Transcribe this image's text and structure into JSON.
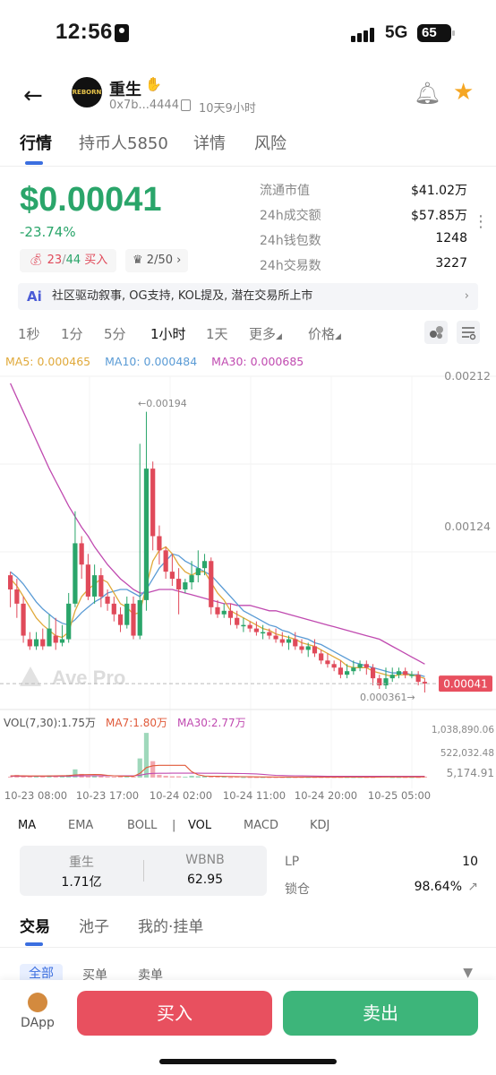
{
  "status_bar": {
    "time": "12:56",
    "network": "5G",
    "battery": "65"
  },
  "header": {
    "token_name": "重生",
    "logo_text": "REBORN",
    "address": "0x7b...4444",
    "age": "10天9小时",
    "icons": [
      "back-arrow-icon",
      "copy-icon",
      "bell-icon",
      "star-icon"
    ]
  },
  "tabs": [
    "行情",
    "持币人5850",
    "详情",
    "风险"
  ],
  "price": {
    "value": "$0.00041",
    "change": "-23.74%",
    "buy_count": "23",
    "sell_count": "44",
    "buy_label": "买入",
    "rank": "2/50",
    "colors": {
      "up": "#2aa56a",
      "down": "#e04a5a"
    }
  },
  "stats": [
    {
      "label": "流通市值",
      "value": "$41.02万"
    },
    {
      "label": "24h成交额",
      "value": "$57.85万"
    },
    {
      "label": "24h钱包数",
      "value": "1248"
    },
    {
      "label": "24h交易数",
      "value": "3227"
    }
  ],
  "narrative": {
    "ai_label": "Ai",
    "text": "社区驱动叙事, OG支持, KOL提及, 潜在交易所上市"
  },
  "timeframes": [
    "1秒",
    "1分",
    "5分",
    "1小时",
    "1天",
    "更多",
    "价格"
  ],
  "active_timeframe": "1小时",
  "ma_legend": {
    "ma5": "MA5: 0.000465",
    "ma10": "MA10: 0.000484",
    "ma30": "MA30: 0.000685"
  },
  "chart_data": {
    "type": "candlestick",
    "watermark": "Ave Pro",
    "y_ticks": [
      "0.00212",
      "0.00124"
    ],
    "current_price_tag": "0.00041",
    "high_annotation": "←0.00194",
    "low_annotation": "0.000361→",
    "x_labels": [
      "10-23 08:00",
      "10-23 17:00",
      "10-24 02:00",
      "10-24 11:00",
      "10-24 20:00",
      "10-25 05:00"
    ],
    "ylim": [
      0.00035,
      0.00214
    ],
    "candles": [
      [
        0.00102,
        0.00094,
        0.00104,
        0.00084
      ],
      [
        0.00094,
        0.00086,
        0.001,
        0.00078
      ],
      [
        0.00086,
        0.00068,
        0.0009,
        0.00064
      ],
      [
        0.00066,
        0.00062,
        0.0007,
        0.0006
      ],
      [
        0.00062,
        0.00066,
        0.0007,
        0.0006
      ],
      [
        0.00066,
        0.00062,
        0.00072,
        0.0006
      ],
      [
        0.00062,
        0.00072,
        0.0008,
        0.00062
      ],
      [
        0.00068,
        0.00064,
        0.00078,
        0.0006
      ],
      [
        0.00064,
        0.00066,
        0.00074,
        0.00062
      ],
      [
        0.00066,
        0.00086,
        0.00092,
        0.00064
      ],
      [
        0.00086,
        0.0012,
        0.00138,
        0.00084
      ],
      [
        0.0012,
        0.00108,
        0.00124,
        0.001
      ],
      [
        0.00108,
        0.0009,
        0.00114,
        0.00088
      ],
      [
        0.0009,
        0.00102,
        0.00108,
        0.00086
      ],
      [
        0.00102,
        0.0009,
        0.00106,
        0.00084
      ],
      [
        0.0009,
        0.00086,
        0.00094,
        0.00082
      ],
      [
        0.00086,
        0.0008,
        0.0009,
        0.00076
      ],
      [
        0.0008,
        0.00074,
        0.00084,
        0.0007
      ],
      [
        0.00074,
        0.00086,
        0.0009,
        0.00072
      ],
      [
        0.00086,
        0.00068,
        0.0009,
        0.00066
      ],
      [
        0.00068,
        0.00088,
        0.00176,
        0.00066
      ],
      [
        0.00088,
        0.00162,
        0.00194,
        0.00082
      ],
      [
        0.00162,
        0.00124,
        0.00166,
        0.00116
      ],
      [
        0.00124,
        0.00116,
        0.0013,
        0.00108
      ],
      [
        0.00116,
        0.00104,
        0.00118,
        0.001
      ],
      [
        0.00104,
        0.001,
        0.00114,
        0.00096
      ],
      [
        0.001,
        0.00094,
        0.00106,
        0.0008
      ],
      [
        0.00094,
        0.00098,
        0.001,
        0.00092
      ],
      [
        0.00098,
        0.00102,
        0.0011,
        0.00094
      ],
      [
        0.00102,
        0.00106,
        0.00116,
        0.00098
      ],
      [
        0.00106,
        0.0011,
        0.00114,
        0.00102
      ],
      [
        0.0011,
        0.00084,
        0.00112,
        0.0008
      ],
      [
        0.00084,
        0.0008,
        0.00088,
        0.00078
      ],
      [
        0.0008,
        0.00082,
        0.00086,
        0.00078
      ],
      [
        0.00082,
        0.00078,
        0.00086,
        0.00074
      ],
      [
        0.00078,
        0.00074,
        0.00082,
        0.00072
      ],
      [
        0.00074,
        0.00074,
        0.00078,
        0.0007
      ],
      [
        0.00074,
        0.00072,
        0.00076,
        0.0007
      ],
      [
        0.00072,
        0.0007,
        0.00076,
        0.00068
      ],
      [
        0.0007,
        0.0007,
        0.00074,
        0.00066
      ],
      [
        0.0007,
        0.00068,
        0.00072,
        0.00066
      ],
      [
        0.00068,
        0.00066,
        0.00072,
        0.00064
      ],
      [
        0.00066,
        0.00064,
        0.0007,
        0.00062
      ],
      [
        0.00064,
        0.00066,
        0.00068,
        0.0006
      ],
      [
        0.00066,
        0.00062,
        0.0007,
        0.0006
      ],
      [
        0.00062,
        0.0006,
        0.00066,
        0.00058
      ],
      [
        0.0006,
        0.00062,
        0.00064,
        0.00056
      ],
      [
        0.00062,
        0.00058,
        0.00066,
        0.00056
      ],
      [
        0.00058,
        0.00054,
        0.0006,
        0.00052
      ],
      [
        0.00054,
        0.00052,
        0.00058,
        0.0005
      ],
      [
        0.00052,
        0.0005,
        0.00054,
        0.00048
      ],
      [
        0.0005,
        0.00046,
        0.00054,
        0.00044
      ],
      [
        0.00046,
        0.00048,
        0.00052,
        0.00044
      ],
      [
        0.00048,
        0.0005,
        0.00054,
        0.00046
      ],
      [
        0.0005,
        0.00052,
        0.00054,
        0.00048
      ],
      [
        0.00052,
        0.0005,
        0.00054,
        0.00046
      ],
      [
        0.0005,
        0.00044,
        0.00052,
        0.0004
      ],
      [
        0.00044,
        0.0004,
        0.00046,
        0.00038
      ],
      [
        0.0004,
        0.00044,
        0.0005,
        0.00038
      ],
      [
        0.00044,
        0.00046,
        0.0005,
        0.00042
      ],
      [
        0.00046,
        0.00048,
        0.0005,
        0.00044
      ],
      [
        0.00048,
        0.00046,
        0.0005,
        0.00044
      ],
      [
        0.00046,
        0.00046,
        0.00048,
        0.00044
      ],
      [
        0.00046,
        0.00042,
        0.00048,
        0.0004
      ],
      [
        0.00042,
        0.00041,
        0.00044,
        0.00036
      ]
    ],
    "ma5": [
      0.001,
      0.00096,
      0.0009,
      0.00084,
      0.00078,
      0.00074,
      0.00071,
      0.00068,
      0.00067,
      0.0007,
      0.00082,
      0.0009,
      0.00094,
      0.00097,
      0.001,
      0.00098,
      0.00092,
      0.00086,
      0.00084,
      0.0008,
      0.00081,
      0.00096,
      0.0011,
      0.00116,
      0.00118,
      0.00114,
      0.00108,
      0.00104,
      0.00102,
      0.00104,
      0.00104,
      0.00098,
      0.00092,
      0.00088,
      0.00082,
      0.0008,
      0.00078,
      0.00076,
      0.00074,
      0.00072,
      0.00071,
      0.00069,
      0.00068,
      0.00067,
      0.00066,
      0.00064,
      0.00063,
      0.00062,
      0.0006,
      0.00058,
      0.00056,
      0.00054,
      0.00051,
      0.0005,
      0.0005,
      0.0005,
      0.00048,
      0.00047,
      0.00046,
      0.00045,
      0.00046,
      0.00046,
      0.00046,
      0.00045,
      0.00044
    ],
    "ma10": [
      0.00104,
      0.00101,
      0.00097,
      0.00092,
      0.00087,
      0.00083,
      0.0008,
      0.00077,
      0.00075,
      0.00074,
      0.00077,
      0.00081,
      0.00084,
      0.00087,
      0.00089,
      0.00092,
      0.00093,
      0.00094,
      0.00094,
      0.00092,
      0.0009,
      0.00094,
      0.001,
      0.00106,
      0.0011,
      0.00114,
      0.00113,
      0.0011,
      0.00108,
      0.00106,
      0.00104,
      0.00102,
      0.00098,
      0.00094,
      0.0009,
      0.00086,
      0.00082,
      0.0008,
      0.00078,
      0.00076,
      0.00074,
      0.00073,
      0.00071,
      0.0007,
      0.00068,
      0.00067,
      0.00066,
      0.00064,
      0.00063,
      0.00061,
      0.00059,
      0.00057,
      0.00055,
      0.00053,
      0.00052,
      0.00051,
      0.0005,
      0.00049,
      0.00048,
      0.00047,
      0.00047,
      0.00047,
      0.00046,
      0.00046,
      0.00045
    ],
    "ma30": [
      0.0021,
      0.00202,
      0.00194,
      0.00186,
      0.00178,
      0.0017,
      0.00162,
      0.00155,
      0.00148,
      0.00141,
      0.00135,
      0.00129,
      0.00124,
      0.00118,
      0.00113,
      0.00108,
      0.00104,
      0.001,
      0.00097,
      0.00094,
      0.00092,
      0.00092,
      0.00093,
      0.00094,
      0.00094,
      0.00094,
      0.00093,
      0.00092,
      0.00091,
      0.0009,
      0.00089,
      0.00088,
      0.00087,
      0.00086,
      0.00086,
      0.00085,
      0.00085,
      0.00085,
      0.00084,
      0.00083,
      0.00082,
      0.00082,
      0.00081,
      0.0008,
      0.00079,
      0.00078,
      0.00077,
      0.00076,
      0.00075,
      0.00074,
      0.00073,
      0.00072,
      0.00071,
      0.0007,
      0.00069,
      0.00068,
      0.00067,
      0.00066,
      0.00064,
      0.00062,
      0.0006,
      0.00058,
      0.00056,
      0.00054,
      0.00052
    ],
    "volume": {
      "legend": {
        "vol": "VOL(7,30):1.75万",
        "ma7": "MA7:1.80万",
        "ma30": "MA30:2.77万"
      },
      "y_ticks": [
        "1,038,890.06",
        "522,032.48",
        "5,174.91"
      ],
      "ylim": [
        0,
        1100000
      ],
      "values": [
        20000,
        60000,
        30000,
        30000,
        40000,
        30000,
        50000,
        30000,
        20000,
        60000,
        180000,
        80000,
        50000,
        40000,
        30000,
        20000,
        20000,
        30000,
        30000,
        20000,
        420000,
        980000,
        360000,
        60000,
        40000,
        30000,
        30000,
        20000,
        40000,
        30000,
        30000,
        20000,
        20000,
        20000,
        10000,
        20000,
        10000,
        10000,
        10000,
        10000,
        10000,
        10000,
        10000,
        10000,
        10000,
        10000,
        10000,
        10000,
        10000,
        10000,
        10000,
        10000,
        10000,
        10000,
        10000,
        10000,
        10000,
        20000,
        20000,
        10000,
        10000,
        10000,
        10000,
        10000,
        20000
      ],
      "ma7": [
        40000,
        40000,
        38000,
        36000,
        36000,
        36000,
        36000,
        40000,
        42000,
        44000,
        58000,
        62000,
        64000,
        66000,
        64000,
        50000,
        40000,
        34000,
        30000,
        28000,
        90000,
        220000,
        260000,
        270000,
        270000,
        270000,
        270000,
        270000,
        130000,
        60000,
        34000,
        30000,
        28000,
        26000,
        24000,
        22000,
        20000,
        18000,
        16000,
        14000,
        14000,
        13000,
        12000,
        12000,
        11000,
        11000,
        11000,
        11000,
        11000,
        11000,
        11000,
        11000,
        11000,
        11000,
        11000,
        11000,
        11000,
        12000,
        13000,
        13000,
        13000,
        14000,
        14000,
        14000,
        15000
      ],
      "ma30": [
        30000,
        30000,
        30000,
        30000,
        30000,
        30000,
        30000,
        30000,
        30000,
        32000,
        36000,
        38000,
        40000,
        40000,
        40000,
        40000,
        40000,
        40000,
        40000,
        40000,
        52000,
        80000,
        92000,
        94000,
        95000,
        96000,
        96000,
        96000,
        96000,
        96000,
        95000,
        94000,
        94000,
        93000,
        92000,
        90000,
        88000,
        84000,
        80000,
        70000,
        58000,
        50000,
        46000,
        42000,
        40000,
        38000,
        36000,
        34000,
        32000,
        30000,
        29000,
        28000,
        28000,
        28000,
        28000,
        28000,
        27000,
        27000,
        27000,
        27000,
        27000,
        27000,
        27000,
        27000,
        27000
      ]
    }
  },
  "indicators": [
    "MA",
    "EMA",
    "BOLL",
    "|",
    "VOL",
    "MACD",
    "KDJ"
  ],
  "active_indicator": "VOL",
  "liquidity": {
    "token_label": "重生",
    "token_amount": "1.71亿",
    "pair_label": "WBNB",
    "pair_amount": "62.95",
    "lp_label": "LP",
    "lp_value": "10",
    "lock_label": "锁仓",
    "lock_value": "98.64%"
  },
  "subtabs": [
    "交易",
    "池子",
    "我的·挂单"
  ],
  "filters": [
    "全部",
    "买单",
    "卖单"
  ],
  "bottom": {
    "dapp_label": "DApp",
    "buy": "买入",
    "sell": "卖出"
  }
}
